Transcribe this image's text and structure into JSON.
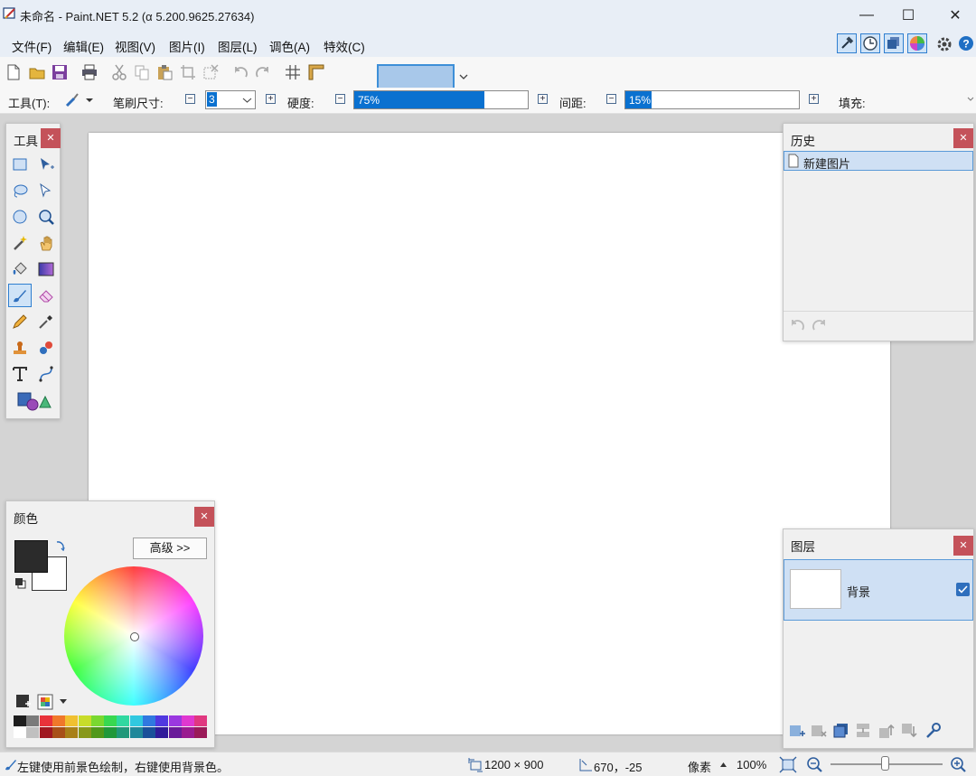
{
  "window": {
    "title": "未命名 - Paint.NET 5.2 (α 5.200.9625.27634)"
  },
  "menu": [
    {
      "label": "文件(F)"
    },
    {
      "label": "编辑(E)"
    },
    {
      "label": "视图(V)"
    },
    {
      "label": "图片(I)"
    },
    {
      "label": "图层(L)"
    },
    {
      "label": "调色(A)"
    },
    {
      "label": "特效(C)"
    }
  ],
  "options": {
    "tool_label": "工具(T):",
    "brush_size_label": "笔刷尺寸:",
    "brush_size_value": "3",
    "hardness_label": "硬度:",
    "hardness_value": "75%",
    "hardness_fraction": 0.75,
    "spacing_label": "间距:",
    "spacing_value": "15%",
    "spacing_fraction": 0.15,
    "fill_label": "填充:"
  },
  "tools_panel": {
    "title": "工具"
  },
  "history_panel": {
    "title": "历史",
    "items": [
      {
        "label": "新建图片"
      }
    ]
  },
  "colors_panel": {
    "title": "颜色",
    "advanced_button": "高级 >>",
    "primary": "#2b2b2b",
    "secondary": "#ffffff"
  },
  "layers_panel": {
    "title": "图层",
    "layers": [
      {
        "name": "背景",
        "visible": true
      }
    ]
  },
  "statusbar": {
    "hint": "左键使用前景色绘制，右键使用背景色。",
    "image_size": "1200 × 900",
    "cursor_pos": "670，-25",
    "units": "像素",
    "zoom": "100%"
  },
  "colors": {
    "accent": "#0a71d0",
    "close": "#c4525a",
    "selection": "#cfe0f4"
  }
}
